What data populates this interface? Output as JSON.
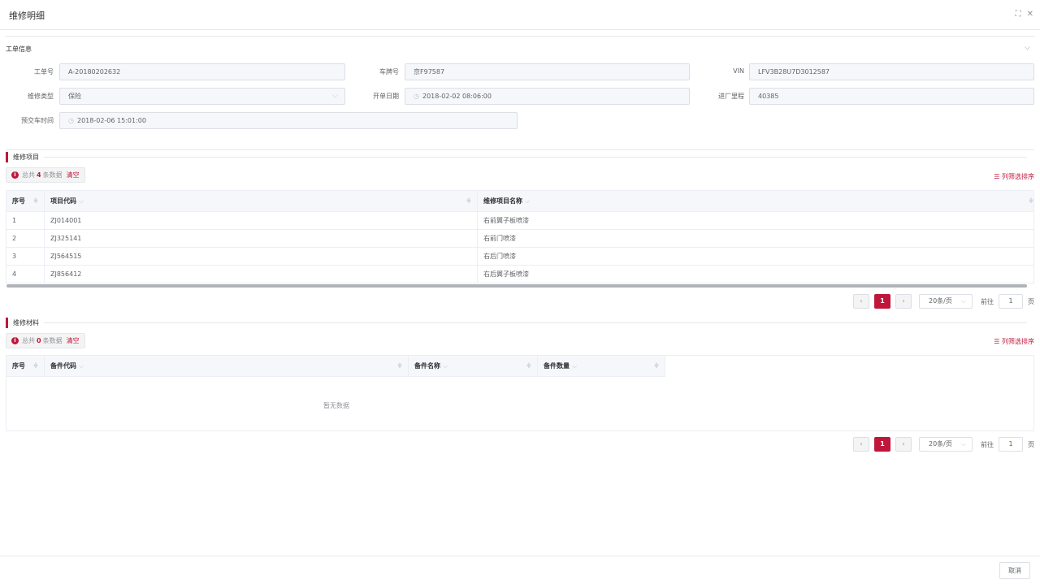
{
  "dialog": {
    "title": "维修明细",
    "fullscreen_icon": "⛶",
    "close_icon": "✕"
  },
  "work_order_info": {
    "section_label": "工单信息",
    "fields": {
      "order_no": {
        "label": "工单号",
        "value": "A-20180202632"
      },
      "plate_no": {
        "label": "车牌号",
        "value": "京F97587"
      },
      "vin": {
        "label": "VIN",
        "value": "LFV3B28U7D3012587"
      },
      "repair_type": {
        "label": "维修类型",
        "value": "保险"
      },
      "open_date": {
        "label": "开单日期",
        "value": "2018-02-02 08:06:00"
      },
      "mileage": {
        "label": "进厂里程",
        "value": "40385"
      },
      "delivery_time": {
        "label": "预交车时间",
        "value": "2018-02-06 15:01:00"
      }
    }
  },
  "repair_items": {
    "section_title": "维修项目",
    "alert": {
      "prefix": "总共",
      "count": "4",
      "suffix": "条数据",
      "clear": "清空"
    },
    "column_filter": "☰ 列筛选排序",
    "columns": [
      "序号",
      "项目代码",
      "维修项目名称"
    ],
    "rows": [
      [
        "1",
        "ZJ014001",
        "右前翼子板喷漆"
      ],
      [
        "2",
        "ZJ325141",
        "右前门喷漆"
      ],
      [
        "3",
        "ZJ564515",
        "右后门喷漆"
      ],
      [
        "4",
        "ZJ856412",
        "右后翼子板喷漆"
      ]
    ],
    "pagination": {
      "current": "1",
      "page_size": "20条/页",
      "goto_label": "前往",
      "goto_value": "1",
      "page_unit": "页"
    }
  },
  "repair_materials": {
    "section_title": "维修材料",
    "alert": {
      "prefix": "总共",
      "count": "0",
      "suffix": "条数据",
      "clear": "清空"
    },
    "column_filter": "☰ 列筛选排序",
    "columns": [
      "序号",
      "备件代码",
      "备件名称",
      "备件数量"
    ],
    "empty_text": "暂无数据",
    "pagination": {
      "current": "1",
      "page_size": "20条/页",
      "goto_label": "前往",
      "goto_value": "1",
      "page_unit": "页"
    }
  },
  "footer": {
    "cancel_label": "取消"
  },
  "colors": {
    "accent": "#c0163b",
    "input_bg": "#f5f7fa",
    "border": "#dcdfe6"
  }
}
